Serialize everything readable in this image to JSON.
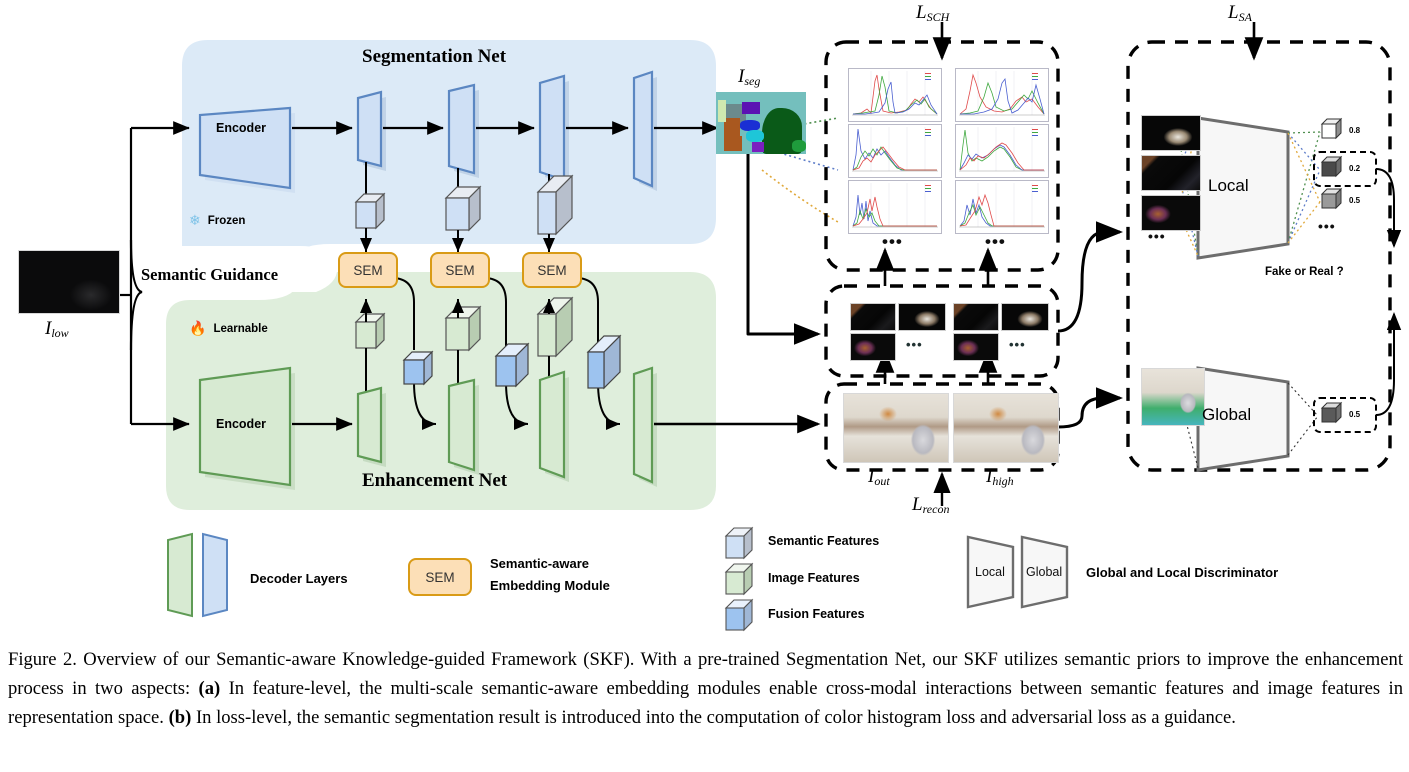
{
  "figure": {
    "caption_parts": [
      {
        "t": "Figure 2. Overview of our Semantic-aware Knowledge-guided Framework (SKF). With a pre-trained Segmentation Net, our SKF utilizes semantic priors to improve the enhancement process in two aspects: ",
        "b": false
      },
      {
        "t": "(a)",
        "b": true
      },
      {
        "t": " In feature-level, the multi-scale semantic-aware embedding modules enable cross-modal interactions between semantic features and image features in representation space. ",
        "b": false
      },
      {
        "t": "(b)",
        "b": true
      },
      {
        "t": " In loss-level, the semantic segmentation result is introduced into the computation of color histogram loss and adversarial loss as a guidance.",
        "b": false
      }
    ],
    "caption_plain": "Figure 2. Overview of our Semantic-aware Knowledge-guided Framework (SKF). With a pre-trained Segmentation Net, our SKF utilizes semantic priors to improve the enhancement process in two aspects: (a) In feature-level, the multi-scale semantic-aware embedding modules enable cross-modal interactions between semantic features and image features in representation space. (b) In loss-level, the semantic segmentation result is introduced into the computation of color histogram loss and adversarial loss as a guidance."
  },
  "segmentation_net": {
    "title": "Segmentation Net",
    "encoder_label": "Encoder",
    "frozen_label": "Frozen",
    "frozen_icon": "snowflake-icon",
    "panel_color": "#dceaf7",
    "layer_color": "#cfe0f5",
    "layer_stroke": "#5b87c2",
    "decoder_count": 4
  },
  "enhancement_net": {
    "title": "Enhancement Net",
    "encoder_label": "Encoder",
    "learnable_label": "Learnable",
    "learnable_icon": "flame-icon",
    "panel_color": "#dfeedc",
    "layer_color": "#d7ead2",
    "layer_stroke": "#5f9b55",
    "decoder_count": 4
  },
  "semantic_guidance": {
    "label": "Semantic Guidance",
    "sem_modules": [
      "SEM",
      "SEM",
      "SEM"
    ],
    "sem_fill": "#fcdfb7",
    "sem_stroke": "#d99b16"
  },
  "inputs": {
    "low_label": "I",
    "low_sub": "low",
    "seg_label": "I",
    "seg_sub": "seg"
  },
  "losses": {
    "sch": {
      "label": "L",
      "sub": "SCH"
    },
    "sa": {
      "label": "L",
      "sub": "SA"
    },
    "recon": {
      "label": "L",
      "sub": "recon"
    }
  },
  "histograms": {
    "count": 6,
    "ellipsis": "•••",
    "legend_colors": [
      "#e04b4b",
      "#3fa83f",
      "#4a5fd0"
    ]
  },
  "recon_row": {
    "out_label": "I",
    "out_sub": "out",
    "high_label": "I",
    "high_sub": "high",
    "ellipsis": "•••"
  },
  "discriminator": {
    "local_label": "Local",
    "global_label": "Global",
    "verdict": "Fake or Real ?",
    "local_scores": [
      "0.8",
      "0.2",
      "0.5"
    ],
    "global_score": "0.5",
    "ellipsis": "•••",
    "body_fill": "#f7f7f7",
    "body_stroke": "#6d6d6d"
  },
  "legend": {
    "decoder_layers": "Decoder Layers",
    "sem_box_label": "SEM",
    "sem_desc_line1": "Semantic-aware",
    "sem_desc_line2": "Embedding Module",
    "feature_items": [
      {
        "label": "Semantic Features",
        "color": "#cfe0f5"
      },
      {
        "label": "Image Features",
        "color": "#d7ead2"
      },
      {
        "label": "Fusion Features",
        "color": "#9dc3ef"
      }
    ],
    "disc_local": "Local",
    "disc_global": "Global",
    "disc_desc": "Global and Local Discriminator"
  }
}
